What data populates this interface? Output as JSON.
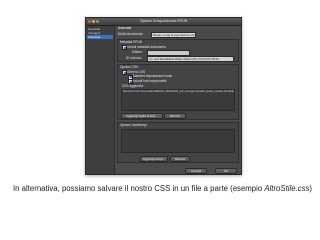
{
  "dialog": {
    "title": "Opzioni di esportazione EPUB",
    "sidebar": {
      "items": [
        "Generale",
        "Immagini",
        "Avanzate"
      ],
      "selected_index": 2
    },
    "header": "Avanzate",
    "split_label": "Dividi documento:",
    "split_value": "Basato su tag di esportazione stil...",
    "metadata": {
      "group_label": "Metadati EPUB",
      "include_label": "Includi metadati documento",
      "include_checked": true,
      "publisher_label": "Editore:",
      "publisher_value": "",
      "id_label": "ID univoco:",
      "id_value": "urn:uuid:BAA2EE0D-B8E1-4DE6-A3FC-63A6D6A78F9C"
    },
    "css": {
      "group_label": "Opzioni CSS",
      "generate_label": "Genera CSS",
      "generate_checked": true,
      "local_label": "Mantieni impostazioni locali",
      "local_checked": true,
      "fonts_label": "Includi font incorporabili",
      "fonts_checked": true,
      "additional_label": "CSS aggiuntivi:",
      "path": "Macintosh HD:Users:Italica:EBOOK_INDESIGN_pdf_immagini:Cartelle_spettri_caselle:AltroStile.css",
      "add_button": "Aggiungi foglio di stile...",
      "remove_button": "Elimina"
    },
    "js": {
      "group_label": "Opzioni JavaScript",
      "add_button": "Aggiungi script...",
      "remove_button": "Elimina"
    },
    "footer": {
      "cancel": "Annulla",
      "ok": "OK"
    }
  },
  "caption": {
    "text": "In alternativa, possiamo salvare il nostro CSS in un file a parte (esempio ",
    "filename": "AltroStile.css",
    "close": ")"
  },
  "colors": {
    "dialog_bg": "#4a4a4a",
    "selection": "#3b6ec8",
    "caption_text": "#222222"
  }
}
